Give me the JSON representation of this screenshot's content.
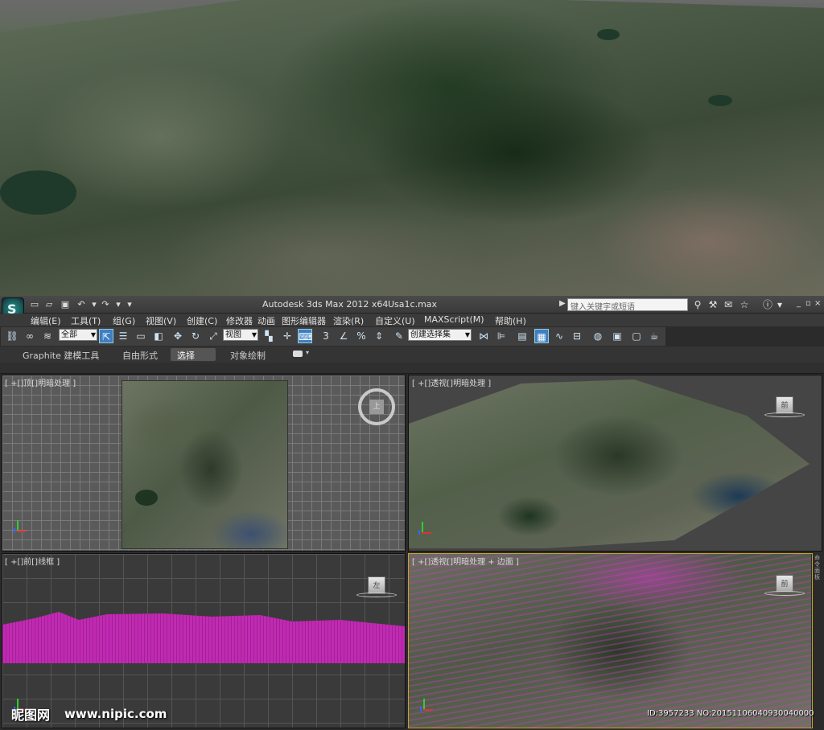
{
  "titlebar": {
    "app_title": "Autodesk 3ds Max  2012 x64",
    "file_name": "Usa1c.max",
    "search_placeholder": "键入关键字或短语",
    "logo_glyph": "S"
  },
  "menu": {
    "items": [
      "编辑(E)",
      "工具(T)",
      "组(G)",
      "视图(V)",
      "创建(C)",
      "修改器",
      "动画",
      "图形编辑器",
      "渲染(R)",
      "自定义(U)",
      "MAXScript(M)",
      "帮助(H)"
    ]
  },
  "toolbar": {
    "selection_filter": "全部",
    "reference_coord": "视图",
    "named_selection": "创建选择集",
    "snap_label": "3",
    "angle_snap_label": "%"
  },
  "ribbon": {
    "tabs": [
      "Graphite 建模工具",
      "自由形式",
      "选择",
      "对象绘制"
    ],
    "active_tab": "选择"
  },
  "viewports": {
    "top": {
      "label": "[ +[]顶[]明暗处理 ]",
      "cube_label": "上"
    },
    "perspective": {
      "label": "[ +[]透视[]明暗处理 ]",
      "cube_label": "前"
    },
    "front": {
      "label": "[ +[]前[]线框 ]",
      "cube_label": "左"
    },
    "perspective_edged": {
      "label": "[ +[]透视[]明暗处理 + 边面 ]",
      "cube_label": "前"
    }
  },
  "side_panel": {
    "label": "命令面板"
  },
  "watermark": {
    "site_name": "昵图网",
    "url": "www.nipic.com",
    "id_text": "ID:3957233 NO:20151106040930040000"
  },
  "colors": {
    "accent_active_button": "#3d7fc2",
    "active_viewport_border": "#c9a227",
    "wireframe_magenta": "#c02ab2"
  }
}
